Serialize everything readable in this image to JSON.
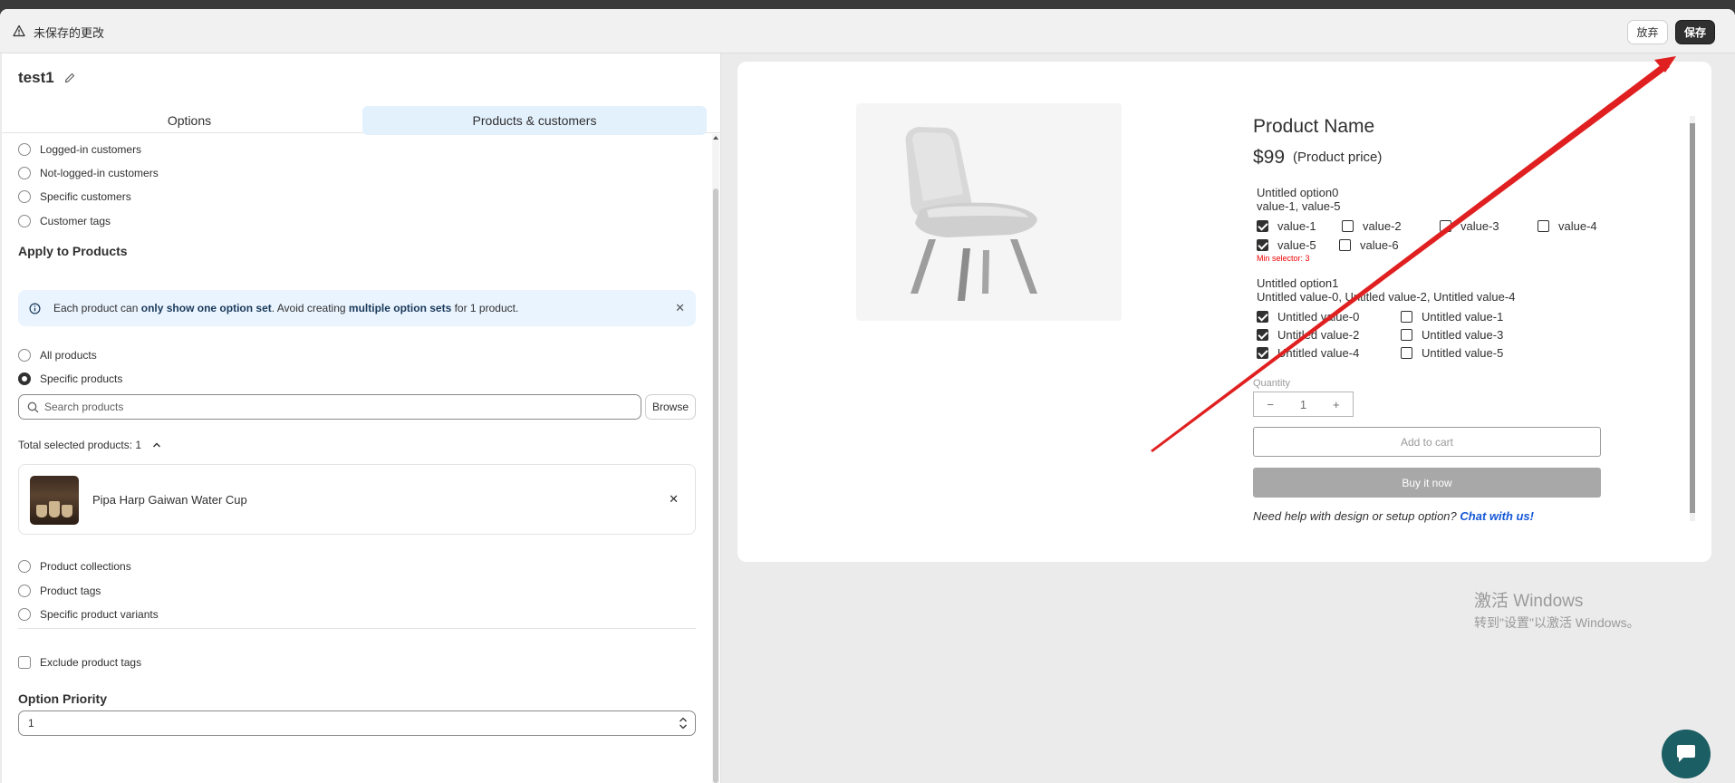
{
  "topbar": {
    "title": "未保存的更改",
    "discard_label": "放弃",
    "save_label": "保存"
  },
  "left": {
    "doc_title": "test1",
    "tabs": [
      {
        "label": "Options",
        "active": false
      },
      {
        "label": "Products & customers",
        "active": true
      }
    ],
    "customer_radios": [
      {
        "label": "Logged-in customers",
        "selected": false
      },
      {
        "label": "Not-logged-in customers",
        "selected": false
      },
      {
        "label": "Specific customers",
        "selected": false
      },
      {
        "label": "Customer tags",
        "selected": false
      }
    ],
    "apply_products_title": "Apply to Products",
    "banner": {
      "p1": "Each product can ",
      "b1": "only show one option set",
      "p2": ". Avoid creating ",
      "b2": "multiple option sets",
      "p3": " for 1 product."
    },
    "product_radios_top": [
      {
        "label": "All products",
        "selected": false
      },
      {
        "label": "Specific products",
        "selected": true
      }
    ],
    "search_placeholder": "Search products",
    "browse_label": "Browse",
    "total_selected": "Total selected products: 1",
    "selected_product": "Pipa Harp Gaiwan Water Cup",
    "product_radios_bottom": [
      {
        "label": "Product collections",
        "selected": false
      },
      {
        "label": "Product tags",
        "selected": false
      },
      {
        "label": "Specific product variants",
        "selected": false
      }
    ],
    "exclude_tags_label": "Exclude product tags",
    "option_priority_title": "Option Priority",
    "option_priority_value": "1"
  },
  "preview": {
    "product_name": "Product Name",
    "price": "$99",
    "price_note": "(Product price)",
    "option0": {
      "name": "Untitled option0",
      "selected_summary": "value-1, value-5",
      "values": [
        {
          "label": "value-1",
          "checked": true
        },
        {
          "label": "value-2",
          "checked": false
        },
        {
          "label": "value-3",
          "checked": false
        },
        {
          "label": "value-4",
          "checked": false
        },
        {
          "label": "value-5",
          "checked": true
        },
        {
          "label": "value-6",
          "checked": false
        }
      ],
      "min_selector": "Min selector: 3"
    },
    "option1": {
      "name": "Untitled option1",
      "selected_summary": "Untitled value-0, Untitled value-2, Untitled value-4",
      "values": [
        {
          "label": "Untitled value-0",
          "checked": true
        },
        {
          "label": "Untitled value-1",
          "checked": false
        },
        {
          "label": "Untitled value-2",
          "checked": true
        },
        {
          "label": "Untitled value-3",
          "checked": false
        },
        {
          "label": "Untitled value-4",
          "checked": true
        },
        {
          "label": "Untitled value-5",
          "checked": false
        }
      ]
    },
    "quantity_label": "Quantity",
    "quantity_minus": "−",
    "quantity_value": "1",
    "quantity_plus": "+",
    "add_to_cart": "Add to cart",
    "buy_now": "Buy it now",
    "help_text": "Need help with design or setup option? ",
    "help_link": "Chat with us!"
  },
  "watermark": {
    "line1": "激活 Windows",
    "line2": "转到\"设置\"以激活 Windows。"
  },
  "colors": {
    "save_button": "#303030",
    "active_tab": "#e3f1fd",
    "banner_bg": "#eaf4ff",
    "link": "#1558d6",
    "error": "#ee0000",
    "annotation_arrow": "#e02020",
    "chat_fab": "#1b5e63"
  },
  "icons": [
    "warning-icon",
    "edit-icon",
    "info-icon",
    "close-icon",
    "search-icon",
    "chevron-up-icon",
    "chat-icon"
  ]
}
